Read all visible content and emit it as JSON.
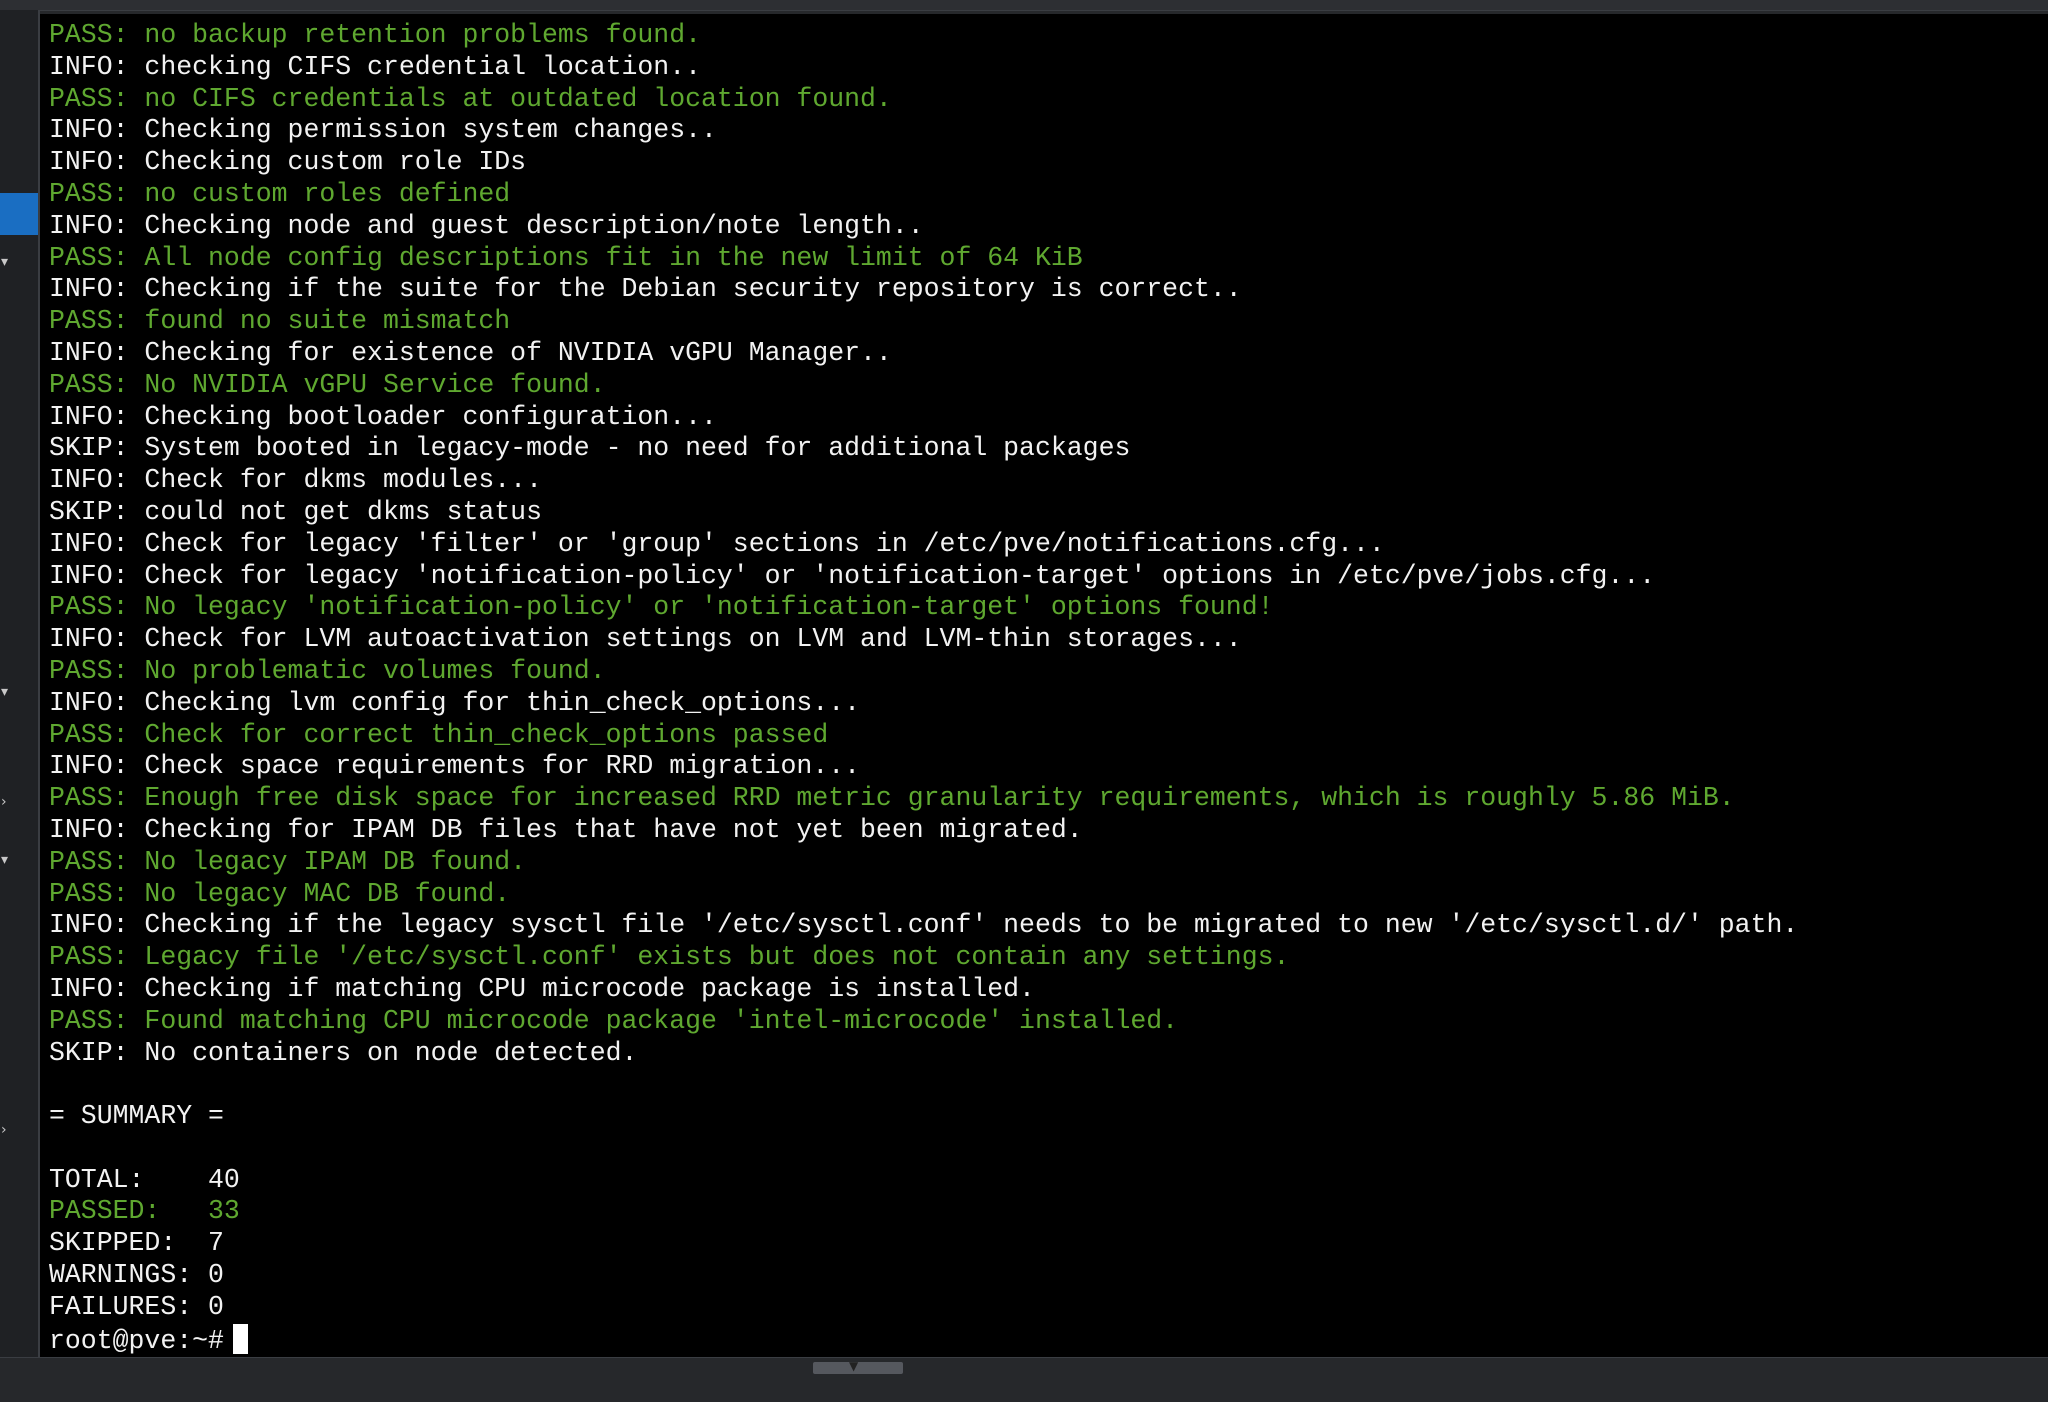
{
  "terminal": {
    "lines": [
      {
        "kind": "pass",
        "text": "PASS: no backup retention problems found."
      },
      {
        "kind": "info",
        "text": "INFO: checking CIFS credential location.."
      },
      {
        "kind": "pass",
        "text": "PASS: no CIFS credentials at outdated location found."
      },
      {
        "kind": "info",
        "text": "INFO: Checking permission system changes.."
      },
      {
        "kind": "info",
        "text": "INFO: Checking custom role IDs"
      },
      {
        "kind": "pass",
        "text": "PASS: no custom roles defined"
      },
      {
        "kind": "info",
        "text": "INFO: Checking node and guest description/note length.."
      },
      {
        "kind": "pass",
        "text": "PASS: All node config descriptions fit in the new limit of 64 KiB"
      },
      {
        "kind": "info",
        "text": "INFO: Checking if the suite for the Debian security repository is correct.."
      },
      {
        "kind": "pass",
        "text": "PASS: found no suite mismatch"
      },
      {
        "kind": "info",
        "text": "INFO: Checking for existence of NVIDIA vGPU Manager.."
      },
      {
        "kind": "pass",
        "text": "PASS: No NVIDIA vGPU Service found."
      },
      {
        "kind": "info",
        "text": "INFO: Checking bootloader configuration..."
      },
      {
        "kind": "skip",
        "text": "SKIP: System booted in legacy-mode - no need for additional packages"
      },
      {
        "kind": "info",
        "text": "INFO: Check for dkms modules..."
      },
      {
        "kind": "skip",
        "text": "SKIP: could not get dkms status"
      },
      {
        "kind": "info",
        "text": "INFO: Check for legacy 'filter' or 'group' sections in /etc/pve/notifications.cfg..."
      },
      {
        "kind": "info",
        "text": "INFO: Check for legacy 'notification-policy' or 'notification-target' options in /etc/pve/jobs.cfg..."
      },
      {
        "kind": "pass",
        "text": "PASS: No legacy 'notification-policy' or 'notification-target' options found!"
      },
      {
        "kind": "info",
        "text": "INFO: Check for LVM autoactivation settings on LVM and LVM-thin storages..."
      },
      {
        "kind": "pass",
        "text": "PASS: No problematic volumes found."
      },
      {
        "kind": "info",
        "text": "INFO: Checking lvm config for thin_check_options..."
      },
      {
        "kind": "pass",
        "text": "PASS: Check for correct thin_check_options passed"
      },
      {
        "kind": "info",
        "text": "INFO: Check space requirements for RRD migration..."
      },
      {
        "kind": "pass",
        "text": "PASS: Enough free disk space for increased RRD metric granularity requirements, which is roughly 5.86 MiB."
      },
      {
        "kind": "info",
        "text": "INFO: Checking for IPAM DB files that have not yet been migrated."
      },
      {
        "kind": "pass",
        "text": "PASS: No legacy IPAM DB found."
      },
      {
        "kind": "pass",
        "text": "PASS: No legacy MAC DB found."
      },
      {
        "kind": "info",
        "text": "INFO: Checking if the legacy sysctl file '/etc/sysctl.conf' needs to be migrated to new '/etc/sysctl.d/' path."
      },
      {
        "kind": "pass",
        "text": "PASS: Legacy file '/etc/sysctl.conf' exists but does not contain any settings."
      },
      {
        "kind": "info",
        "text": "INFO: Checking if matching CPU microcode package is installed."
      },
      {
        "kind": "pass",
        "text": "PASS: Found matching CPU microcode package 'intel-microcode' installed."
      },
      {
        "kind": "skip",
        "text": "SKIP: No containers on node detected."
      },
      {
        "kind": "blank",
        "text": ""
      },
      {
        "kind": "plain",
        "text": "= SUMMARY ="
      },
      {
        "kind": "blank",
        "text": ""
      },
      {
        "kind": "plain",
        "text": "TOTAL:    40"
      },
      {
        "kind": "pass",
        "text": "PASSED:   33"
      },
      {
        "kind": "plain",
        "text": "SKIPPED:  7"
      },
      {
        "kind": "plain",
        "text": "WARNINGS: 0"
      },
      {
        "kind": "plain",
        "text": "FAILURES: 0"
      }
    ],
    "prompt": "root@pve:~#"
  },
  "colors": {
    "pass": "#5fa830",
    "info": "#f2f2f2",
    "background": "#000000",
    "sidebar_selection": "#1a6ec2"
  },
  "icons": [
    "chevron-down-icon",
    "chevron-right-icon",
    "cursor-block"
  ]
}
